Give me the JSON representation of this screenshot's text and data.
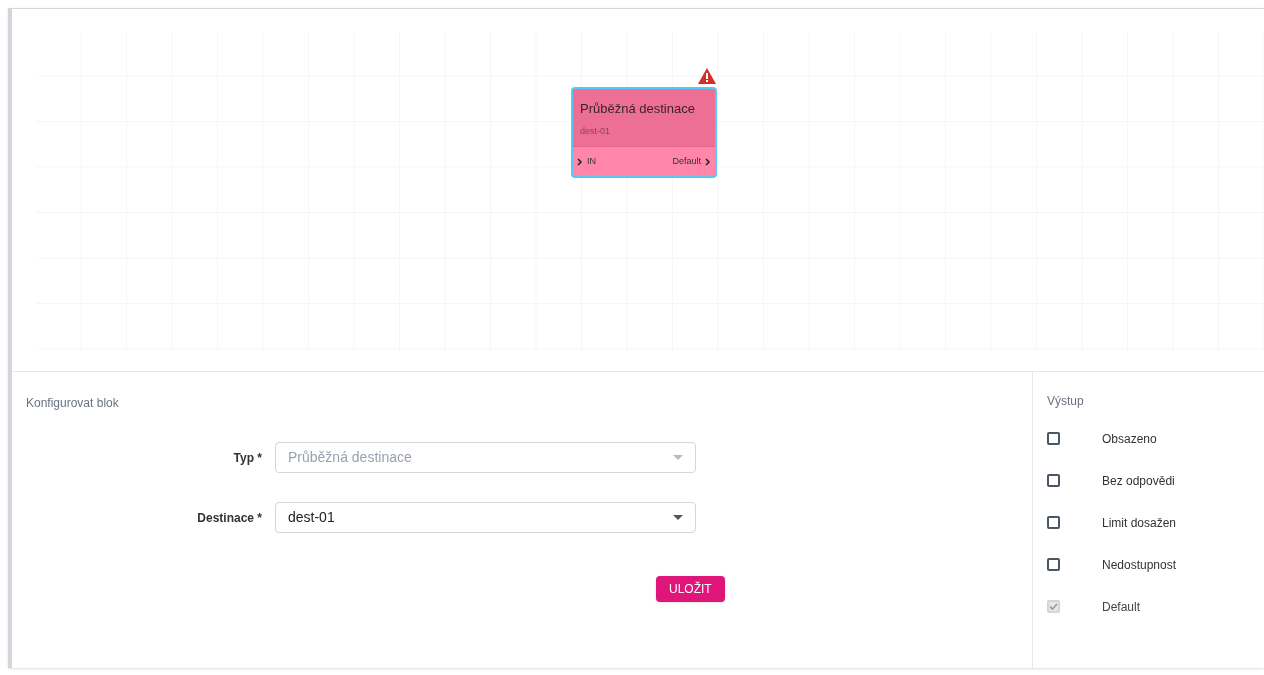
{
  "canvas": {
    "node": {
      "title": "Průběžná destinace",
      "subtitle": "dest-01",
      "input": "IN",
      "output": "Default",
      "warning": true
    }
  },
  "config": {
    "title": "Konfigurovat blok",
    "fields": [
      {
        "label": "Typ *",
        "value": "Průběžná destinace",
        "disabled": true
      },
      {
        "label": "Destinace *",
        "value": "dest-01",
        "disabled": false
      }
    ],
    "save_button": "ULOŽIT"
  },
  "outputs": {
    "title": "Výstup",
    "items": [
      {
        "label": "Obsazeno",
        "checked": false,
        "disabled": false
      },
      {
        "label": "Bez odpovědi",
        "checked": false,
        "disabled": false
      },
      {
        "label": "Limit dosažen",
        "checked": false,
        "disabled": false
      },
      {
        "label": "Nedostupnost",
        "checked": false,
        "disabled": false
      },
      {
        "label": "Default",
        "checked": true,
        "disabled": true
      }
    ]
  }
}
